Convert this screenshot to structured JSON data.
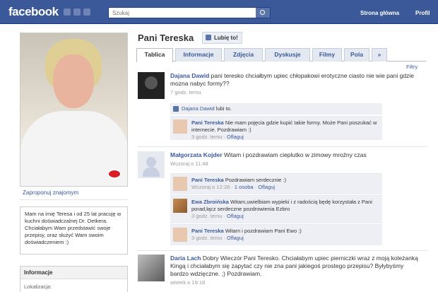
{
  "topbar": {
    "logo": "facebook",
    "search_placeholder": "Szukaj",
    "nav_home": "Strona główna",
    "nav_profile": "Profil"
  },
  "profile": {
    "name": "Pani Tereska",
    "like_button": "Lubię to!",
    "suggest_link": "Zaproponuj znajomym",
    "bio": "Mam na imię Teresa i od 25 lat pracuję w kuchni doświadczalnej Dr. Oetkera. Chciałabym Wam przedstawić swoje przepisy, oraz służyć Wam swoim doświadczeniem :)",
    "info_heading": "Informacje",
    "info_location_label": "Lokalizacja:"
  },
  "tabs": [
    {
      "label": "Tablica"
    },
    {
      "label": "Informacje"
    },
    {
      "label": "Zdjęcia"
    },
    {
      "label": "Dyskusje"
    },
    {
      "label": "Filmy"
    },
    {
      "label": "Pola"
    },
    {
      "label": "»"
    }
  ],
  "filters_label": "Filtry",
  "posts": [
    {
      "author": "Dajana Dawid",
      "text": "pani teresko chciałbym upiec chłopakowi erotyczne ciasto nie wie pani gdzie mozna nabyc formy??",
      "time": "7 godz. temu",
      "likes": {
        "name": "Dajana Dawid",
        "suffix": "lubi to."
      },
      "comments": [
        {
          "author": "Pani Tereska",
          "text": "Nie mam pojęcia gdzie kupić takie formy. Może Pani poszukać w internecie. Pozdrawiam :)",
          "time": "3 godz. temu",
          "action": "Oflaguj"
        }
      ]
    },
    {
      "author": "Małgorzata Kojder",
      "text": "Witam i pozdrawiam cieplutko w zimowy mroźny czas",
      "time": "Wczoraj o 11:48",
      "comments": [
        {
          "author": "Pani Tereska",
          "text": "Pozdrawiam serdecznie :)",
          "time": "Wczoraj o 12:28",
          "likes": "1 osoba",
          "action": "Oflaguj"
        },
        {
          "author": "Ewa Zbroińska",
          "text": "Witam,uwielbiam wypieki i z radością będę korzystała z Pani porad,łącz serdeczne pozdrowienia Ezbro",
          "time": "3 godz. temu",
          "action": "Oflaguj"
        },
        {
          "author": "Pani Tereska",
          "text": "Witam i pozdrawiam Pani Ewo :)",
          "time": "3 godz. temu",
          "action": "Oflaguj"
        }
      ]
    },
    {
      "author": "Daria Lach",
      "text": "Dobry Wieczór Pani Teresko. Chciałabym upiec pierniczki wraz z moją koleżanką Kingą i chciałabym się zapytać czy nie zna pani jakiegoś prostego przepisu? Byłybyśmy bardzo wdzięczne. ;) Pozdrawiam.",
      "time": "wtorek o 19:18"
    }
  ]
}
